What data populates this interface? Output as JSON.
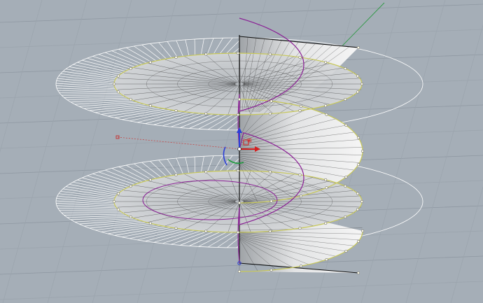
{
  "viewport": {
    "view": "perspective",
    "background_color": "#a5aeb7",
    "grid_major_color": "#8f98a2",
    "grid_minor_color": "#9ba4ad",
    "surface_color": "#e3e4e5",
    "wire_color": "#ffffff",
    "edge_color": "#111111",
    "selection_color": "#c8c85a",
    "curve_color": "#8a1f95",
    "axis_x_color": "#d52020",
    "axis_y_color": "#1b9a3a",
    "axis_z_color": "#2b3fd8",
    "gumball_label": "⊞"
  }
}
